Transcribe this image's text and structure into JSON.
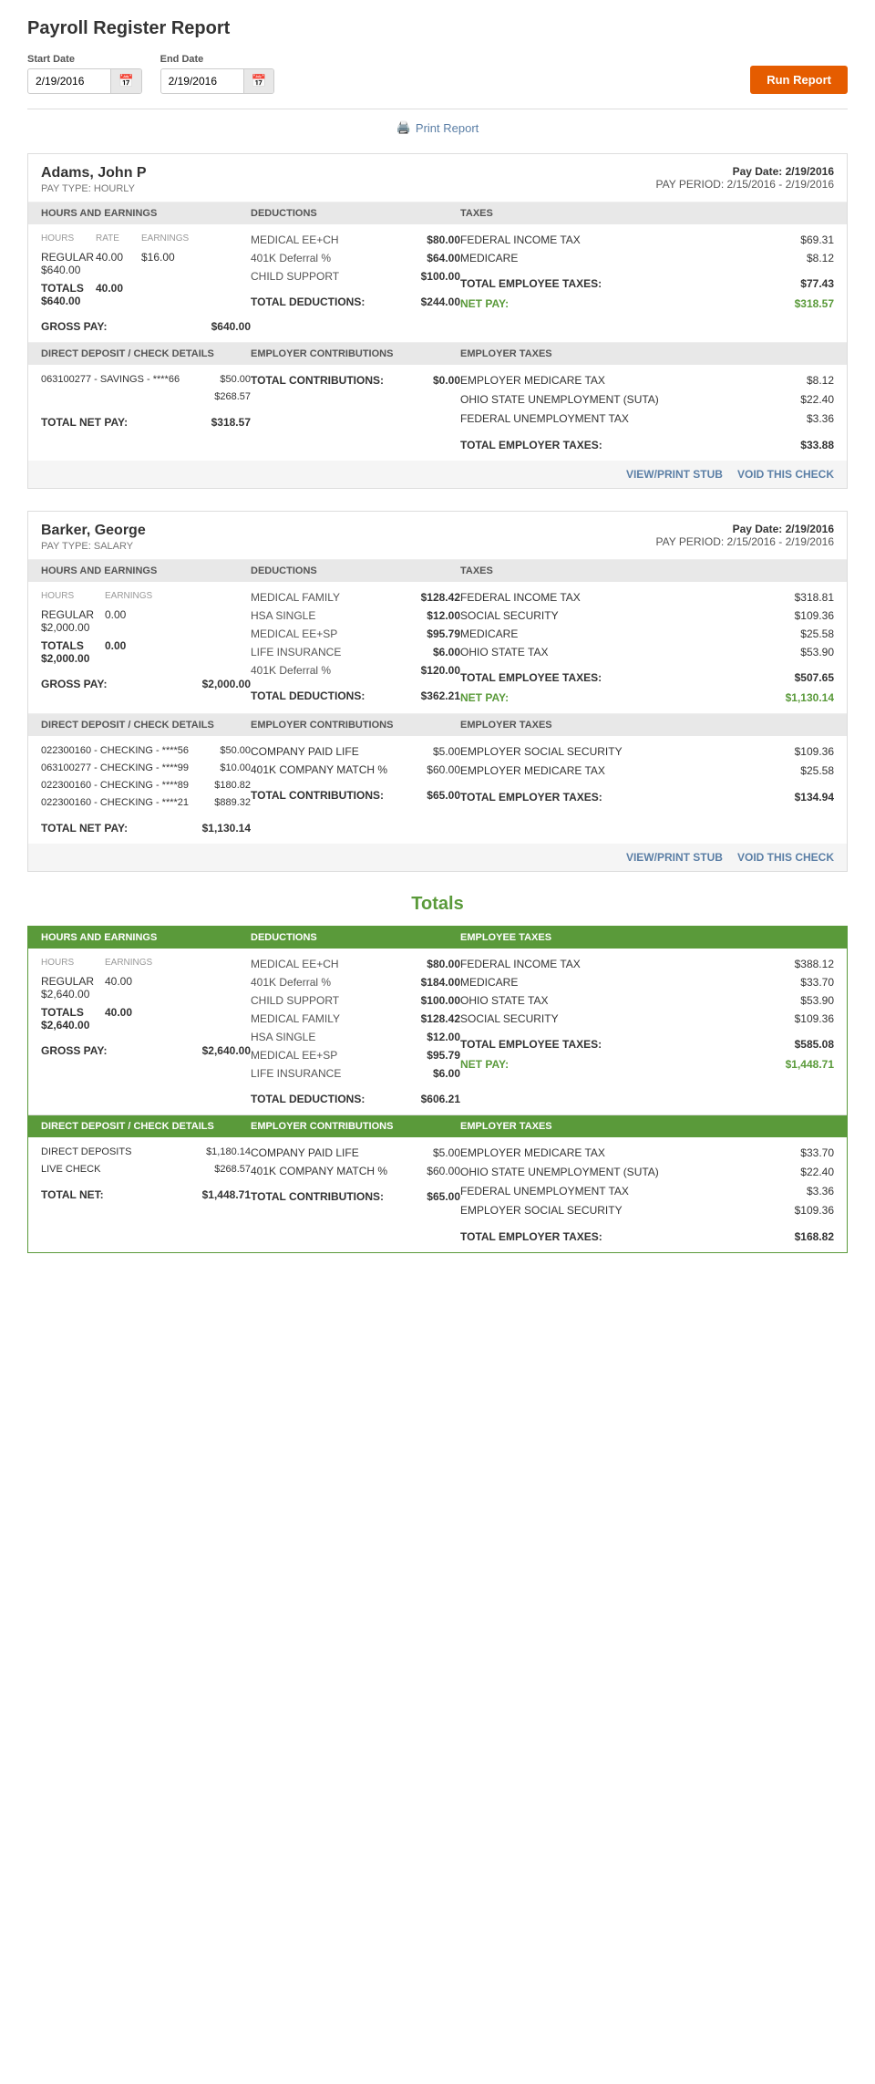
{
  "page": {
    "title": "Payroll Register Report"
  },
  "filters": {
    "start_date_label": "Start Date",
    "start_date_value": "2/19/2016",
    "end_date_label": "End Date",
    "end_date_value": "2/19/2016",
    "run_report_label": "Run Report",
    "print_report_label": "Print Report"
  },
  "employee1": {
    "name": "Adams, John P",
    "pay_type": "PAY TYPE: HOURLY",
    "pay_date": "Pay Date: 2/19/2016",
    "pay_period": "PAY PERIOD: 2/15/2016 - 2/19/2016",
    "section_headers": {
      "col1": "HOURS AND EARNINGS",
      "col2": "DEDUCTIONS",
      "col3": "TAXES"
    },
    "hours_earnings": {
      "sub_headers": [
        "HOURS",
        "RATE",
        "EARNINGS"
      ],
      "rows": [
        {
          "label": "REGULAR",
          "hours": "40.00",
          "rate": "$16.00",
          "earnings": "$640.00"
        }
      ],
      "totals": {
        "label": "TOTALS",
        "hours": "40.00",
        "earnings": "$640.00"
      },
      "gross_pay_label": "GROSS PAY:",
      "gross_pay_value": "$640.00"
    },
    "deductions": {
      "rows": [
        {
          "label": "MEDICAL EE+CH",
          "value": "$80.00"
        },
        {
          "label": "401K Deferral %",
          "value": "$64.00"
        },
        {
          "label": "CHILD SUPPORT",
          "value": "$100.00"
        }
      ],
      "total_label": "TOTAL DEDUCTIONS:",
      "total_value": "$244.00"
    },
    "taxes": {
      "rows": [
        {
          "label": "FEDERAL INCOME TAX",
          "value": "$69.31"
        },
        {
          "label": "MEDICARE",
          "value": "$8.12"
        }
      ],
      "total_label": "TOTAL EMPLOYEE TAXES:",
      "total_value": "$77.43",
      "net_pay_label": "NET PAY:",
      "net_pay_value": "$318.57"
    },
    "section2_headers": {
      "col1": "DIRECT DEPOSIT / CHECK DETAILS",
      "col2": "EMPLOYER CONTRIBUTIONS",
      "col3": "EMPLOYER TAXES"
    },
    "direct_deposit": {
      "rows": [
        {
          "label": "063100277 - SAVINGS - ****66",
          "value": "$50.00"
        },
        {
          "label": "",
          "value": "$268.57"
        }
      ],
      "total_label": "TOTAL NET PAY:",
      "total_value": "$318.57"
    },
    "employer_contributions": {
      "rows": [],
      "total_label": "TOTAL CONTRIBUTIONS:",
      "total_value": "$0.00"
    },
    "employer_taxes": {
      "rows": [
        {
          "label": "EMPLOYER MEDICARE TAX",
          "value": "$8.12"
        },
        {
          "label": "OHIO STATE UNEMPLOYMENT (SUTA)",
          "value": "$22.40"
        },
        {
          "label": "FEDERAL UNEMPLOYMENT TAX",
          "value": "$3.36"
        }
      ],
      "total_label": "TOTAL EMPLOYER TAXES:",
      "total_value": "$33.88"
    },
    "actions": {
      "view_print_stub": "VIEW/PRINT STUB",
      "void_check": "VOID THIS CHECK"
    }
  },
  "employee2": {
    "name": "Barker, George",
    "pay_type": "PAY TYPE: SALARY",
    "pay_date": "Pay Date: 2/19/2016",
    "pay_period": "PAY PERIOD: 2/15/2016 - 2/19/2016",
    "section_headers": {
      "col1": "HOURS AND EARNINGS",
      "col2": "DEDUCTIONS",
      "col3": "TAXES"
    },
    "hours_earnings": {
      "sub_headers": [
        "HOURS",
        "EARNINGS"
      ],
      "rows": [
        {
          "label": "REGULAR",
          "hours": "0.00",
          "earnings": "$2,000.00"
        }
      ],
      "totals": {
        "label": "TOTALS",
        "hours": "0.00",
        "earnings": "$2,000.00"
      },
      "gross_pay_label": "GROSS PAY:",
      "gross_pay_value": "$2,000.00"
    },
    "deductions": {
      "rows": [
        {
          "label": "MEDICAL FAMILY",
          "value": "$128.42"
        },
        {
          "label": "HSA SINGLE",
          "value": "$12.00"
        },
        {
          "label": "MEDICAL EE+SP",
          "value": "$95.79"
        },
        {
          "label": "LIFE INSURANCE",
          "value": "$6.00"
        },
        {
          "label": "401K Deferral %",
          "value": "$120.00"
        }
      ],
      "total_label": "TOTAL DEDUCTIONS:",
      "total_value": "$362.21"
    },
    "taxes": {
      "rows": [
        {
          "label": "FEDERAL INCOME TAX",
          "value": "$318.81"
        },
        {
          "label": "SOCIAL SECURITY",
          "value": "$109.36"
        },
        {
          "label": "MEDICARE",
          "value": "$25.58"
        },
        {
          "label": "OHIO STATE TAX",
          "value": "$53.90"
        }
      ],
      "total_label": "TOTAL EMPLOYEE TAXES:",
      "total_value": "$507.65",
      "net_pay_label": "NET PAY:",
      "net_pay_value": "$1,130.14"
    },
    "section2_headers": {
      "col1": "DIRECT DEPOSIT / CHECK DETAILS",
      "col2": "EMPLOYER CONTRIBUTIONS",
      "col3": "EMPLOYER TAXES"
    },
    "direct_deposit": {
      "rows": [
        {
          "label": "022300160 - CHECKING - ****56",
          "value": "$50.00"
        },
        {
          "label": "063100277 - CHECKING - ****99",
          "value": "$10.00"
        },
        {
          "label": "022300160 - CHECKING - ****89",
          "value": "$180.82"
        },
        {
          "label": "022300160 - CHECKING - ****21",
          "value": "$889.32"
        }
      ],
      "total_label": "TOTAL NET PAY:",
      "total_value": "$1,130.14"
    },
    "employer_contributions": {
      "rows": [
        {
          "label": "COMPANY PAID LIFE",
          "value": "$5.00"
        },
        {
          "label": "401K COMPANY MATCH %",
          "value": "$60.00"
        }
      ],
      "total_label": "TOTAL CONTRIBUTIONS:",
      "total_value": "$65.00"
    },
    "employer_taxes": {
      "rows": [
        {
          "label": "EMPLOYER SOCIAL SECURITY",
          "value": "$109.36"
        },
        {
          "label": "EMPLOYER MEDICARE TAX",
          "value": "$25.58"
        }
      ],
      "total_label": "TOTAL EMPLOYER TAXES:",
      "total_value": "$134.94"
    },
    "actions": {
      "view_print_stub": "VIEW/PRINT STUB",
      "void_check": "VOID THIS CHECK"
    }
  },
  "totals": {
    "title": "Totals",
    "section_headers": {
      "col1": "HOURS AND EARNINGS",
      "col2": "DEDUCTIONS",
      "col3": "EMPLOYEE TAXES"
    },
    "hours_earnings": {
      "sub_headers": [
        "HOURS",
        "EARNINGS"
      ],
      "rows": [
        {
          "label": "REGULAR",
          "hours": "40.00",
          "earnings": "$2,640.00"
        }
      ],
      "totals": {
        "label": "TOTALS",
        "hours": "40.00",
        "earnings": "$2,640.00"
      },
      "gross_pay_label": "GROSS PAY:",
      "gross_pay_value": "$2,640.00"
    },
    "deductions": {
      "rows": [
        {
          "label": "MEDICAL EE+CH",
          "value": "$80.00"
        },
        {
          "label": "401K Deferral %",
          "value": "$184.00"
        },
        {
          "label": "CHILD SUPPORT",
          "value": "$100.00"
        },
        {
          "label": "MEDICAL FAMILY",
          "value": "$128.42"
        },
        {
          "label": "HSA SINGLE",
          "value": "$12.00"
        },
        {
          "label": "MEDICAL EE+SP",
          "value": "$95.79"
        },
        {
          "label": "LIFE INSURANCE",
          "value": "$6.00"
        }
      ],
      "total_label": "TOTAL DEDUCTIONS:",
      "total_value": "$606.21"
    },
    "taxes": {
      "rows": [
        {
          "label": "FEDERAL INCOME TAX",
          "value": "$388.12"
        },
        {
          "label": "MEDICARE",
          "value": "$33.70"
        },
        {
          "label": "OHIO STATE TAX",
          "value": "$53.90"
        },
        {
          "label": "SOCIAL SECURITY",
          "value": "$109.36"
        }
      ],
      "total_label": "TOTAL EMPLOYEE TAXES:",
      "total_value": "$585.08",
      "net_pay_label": "NET PAY:",
      "net_pay_value": "$1,448.71"
    },
    "section2_headers": {
      "col1": "DIRECT DEPOSIT / CHECK DETAILS",
      "col2": "EMPLOYER CONTRIBUTIONS",
      "col3": "EMPLOYER TAXES"
    },
    "direct_deposit": {
      "rows": [
        {
          "label": "DIRECT DEPOSITS",
          "value": "$1,180.14"
        },
        {
          "label": "LIVE CHECK",
          "value": "$268.57"
        }
      ],
      "total_label": "TOTAL NET:",
      "total_value": "$1,448.71"
    },
    "employer_contributions": {
      "rows": [
        {
          "label": "COMPANY PAID LIFE",
          "value": "$5.00"
        },
        {
          "label": "401K COMPANY MATCH %",
          "value": "$60.00"
        }
      ],
      "total_label": "TOTAL CONTRIBUTIONS:",
      "total_value": "$65.00"
    },
    "employer_taxes": {
      "rows": [
        {
          "label": "EMPLOYER MEDICARE TAX",
          "value": "$33.70"
        },
        {
          "label": "OHIO STATE UNEMPLOYMENT (SUTA)",
          "value": "$22.40"
        },
        {
          "label": "FEDERAL UNEMPLOYMENT TAX",
          "value": "$3.36"
        },
        {
          "label": "EMPLOYER SOCIAL SECURITY",
          "value": "$109.36"
        }
      ],
      "total_label": "TOTAL EMPLOYER TAXES:",
      "total_value": "$168.82"
    }
  }
}
